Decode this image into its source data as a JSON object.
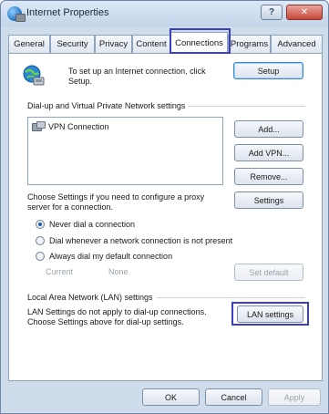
{
  "window": {
    "title": "Internet Properties",
    "help_label": "?",
    "close_label": "✕"
  },
  "tabs": [
    {
      "label": "General"
    },
    {
      "label": "Security"
    },
    {
      "label": "Privacy"
    },
    {
      "label": "Content"
    },
    {
      "label": "Connections",
      "active": true
    },
    {
      "label": "Programs"
    },
    {
      "label": "Advanced"
    }
  ],
  "setup": {
    "text": "To set up an Internet connection, click Setup.",
    "button_label": "Setup"
  },
  "dialup": {
    "section_label": "Dial-up and Virtual Private Network settings",
    "connections": [
      {
        "label": "VPN Connection"
      }
    ],
    "add_label": "Add...",
    "add_vpn_label": "Add VPN...",
    "remove_label": "Remove...",
    "proxy_text": "Choose Settings if you need to configure a proxy server for a connection.",
    "settings_label": "Settings",
    "options": [
      {
        "label": "Never dial a connection",
        "checked": true
      },
      {
        "label": "Dial whenever a network connection is not present",
        "checked": false
      },
      {
        "label": "Always dial my default connection",
        "checked": false
      }
    ],
    "current_label": "Current",
    "current_value": "None",
    "set_default_label": "Set default"
  },
  "lan": {
    "section_label": "Local Area Network (LAN) settings",
    "text": "LAN Settings do not apply to dial-up connections. Choose Settings above for dial-up settings.",
    "button_label": "LAN settings"
  },
  "footer": {
    "ok_label": "OK",
    "cancel_label": "Cancel",
    "apply_label": "Apply"
  },
  "colors": {
    "highlight": "#3a3fc4",
    "window_frame": "#cfdcec"
  }
}
